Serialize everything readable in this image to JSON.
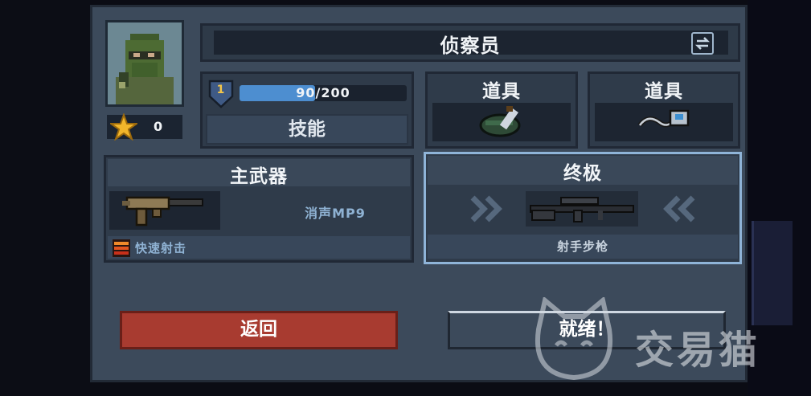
{
  "character": {
    "name": "侦察员",
    "stars": "0",
    "level": "1",
    "xp_text": "90/200",
    "xp_fraction": 0.45
  },
  "skill_label": "技能",
  "items": [
    {
      "label": "道具",
      "icon": "grenade-icon"
    },
    {
      "label": "道具",
      "icon": "detonator-icon"
    }
  ],
  "primary_weapon": {
    "header": "主武器",
    "name": "消声MP9",
    "trait": "快速射击"
  },
  "ultimate": {
    "header": "终极",
    "name": "射手步枪"
  },
  "buttons": {
    "back": "返回",
    "ready": "就绪！"
  },
  "watermark": "交易猫",
  "colors": {
    "panel": "#3c4a5b",
    "back_button": "#a83b30",
    "xp_fill": "#4d8ed0",
    "ultimate_border": "#8fb4d8"
  }
}
